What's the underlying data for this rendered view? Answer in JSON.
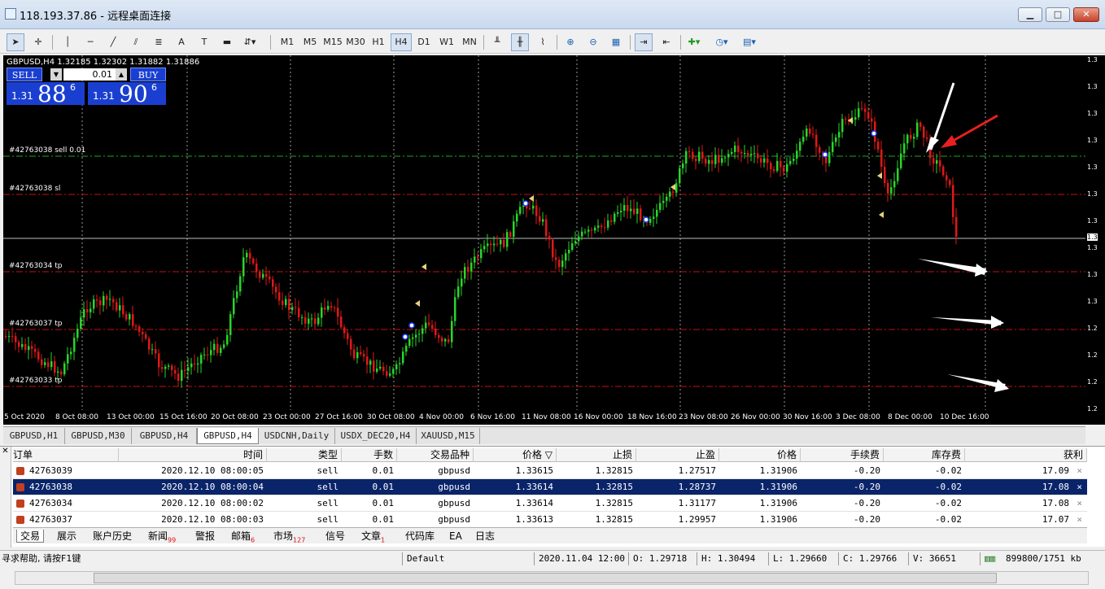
{
  "window": {
    "title": "118.193.37.86 - 远程桌面连接",
    "minimize": "▁",
    "maximize": "□",
    "close": "✕"
  },
  "toolbar": {
    "timeframes": [
      "M1",
      "M5",
      "M15",
      "M30",
      "H1",
      "H4",
      "D1",
      "W1",
      "MN"
    ],
    "active_timeframe": "H4"
  },
  "chart": {
    "symbol_info": "GBPUSD,H4  1.32185  1.32302  1.31882  1.31886",
    "sell_label": "SELL",
    "buy_label": "BUY",
    "lot": "0.01",
    "sell_price": {
      "prefix": "1.31",
      "big": "88",
      "sup": "6"
    },
    "buy_price": {
      "prefix": "1.31",
      "big": "90",
      "sup": "6"
    },
    "order_lines": [
      {
        "label": "#42763038 sell 0.01",
        "color": "#1fa81f"
      },
      {
        "label": "#42763038 sl",
        "color": "#c81010"
      },
      {
        "label": "#42763034 tp",
        "color": "#c81010"
      },
      {
        "label": "#42763037 tp",
        "color": "#c81010"
      },
      {
        "label": "#42763033 tp",
        "color": "#c81010"
      }
    ],
    "date_labels": [
      "5 Oct 2020",
      "8 Oct 08:00",
      "13 Oct 00:00",
      "15 Oct 16:00",
      "20 Oct 08:00",
      "23 Oct 00:00",
      "27 Oct 16:00",
      "30 Oct 08:00",
      "4 Nov 00:00",
      "6 Nov 16:00",
      "11 Nov 08:00",
      "16 Nov 00:00",
      "18 Nov 16:00",
      "23 Nov 08:00",
      "26 Nov 00:00",
      "30 Nov 16:00",
      "3 Dec 08:00",
      "8 Dec 00:00",
      "10 Dec 16:00"
    ],
    "right_scale": [
      "1.3",
      "1.3",
      "1.3",
      "1.3",
      "1.3",
      "1.3",
      "1.3",
      "1.3",
      "1.3",
      "1.3",
      "1.2",
      "1.2",
      "1.2",
      "1.2"
    ],
    "current_price_tag": "1.3",
    "bull_color": "#29d629",
    "bear_color": "#e01818"
  },
  "chart_tabs": [
    "GBPUSD,H1",
    "GBPUSD,M30",
    "GBPUSD,H4",
    "GBPUSD,H4",
    "USDCNH,Daily",
    "USDX_DEC20,H4",
    "XAUUSD,M15"
  ],
  "active_chart_tab": 3,
  "terminal": {
    "side_label": "✕",
    "columns": [
      "订单",
      "时间",
      "类型",
      "手数",
      "交易品种",
      "价格 ▽",
      "止损",
      "止盈",
      "价格",
      "手续费",
      "库存费",
      "获利"
    ],
    "rows": [
      [
        "42763039",
        "2020.12.10 08:00:05",
        "sell",
        "0.01",
        "gbpusd",
        "1.33615",
        "1.32815",
        "1.27517",
        "1.31906",
        "-0.20",
        "-0.02",
        "17.09"
      ],
      [
        "42763038",
        "2020.12.10 08:00:04",
        "sell",
        "0.01",
        "gbpusd",
        "1.33614",
        "1.32815",
        "1.28737",
        "1.31906",
        "-0.20",
        "-0.02",
        "17.08"
      ],
      [
        "42763034",
        "2020.12.10 08:00:02",
        "sell",
        "0.01",
        "gbpusd",
        "1.33614",
        "1.32815",
        "1.31177",
        "1.31906",
        "-0.20",
        "-0.02",
        "17.08"
      ],
      [
        "42763037",
        "2020.12.10 08:00:03",
        "sell",
        "0.01",
        "gbpusd",
        "1.33613",
        "1.32815",
        "1.29957",
        "1.31906",
        "-0.20",
        "-0.02",
        "17.07"
      ]
    ],
    "selected_row": 1,
    "tabs": [
      {
        "label": "交易",
        "badge": ""
      },
      {
        "label": "展示",
        "badge": ""
      },
      {
        "label": "账户历史",
        "badge": ""
      },
      {
        "label": "新闻",
        "badge": "99"
      },
      {
        "label": "警报",
        "badge": ""
      },
      {
        "label": "邮箱",
        "badge": "6"
      },
      {
        "label": "市场",
        "badge": "127"
      },
      {
        "label": "信号",
        "badge": ""
      },
      {
        "label": "文章",
        "badge": "1"
      },
      {
        "label": "代码库",
        "badge": ""
      },
      {
        "label": "EA",
        "badge": ""
      },
      {
        "label": "日志",
        "badge": ""
      }
    ]
  },
  "status": {
    "help": "寻求帮助, 请按F1键",
    "profile": "Default",
    "datetime": "2020.11.04 12:00",
    "open": "O: 1.29718",
    "high": "H: 1.30494",
    "low": "L: 1.29660",
    "close": "C: 1.29766",
    "volume": "V: 36651",
    "traffic": "899800/1751 kb"
  }
}
